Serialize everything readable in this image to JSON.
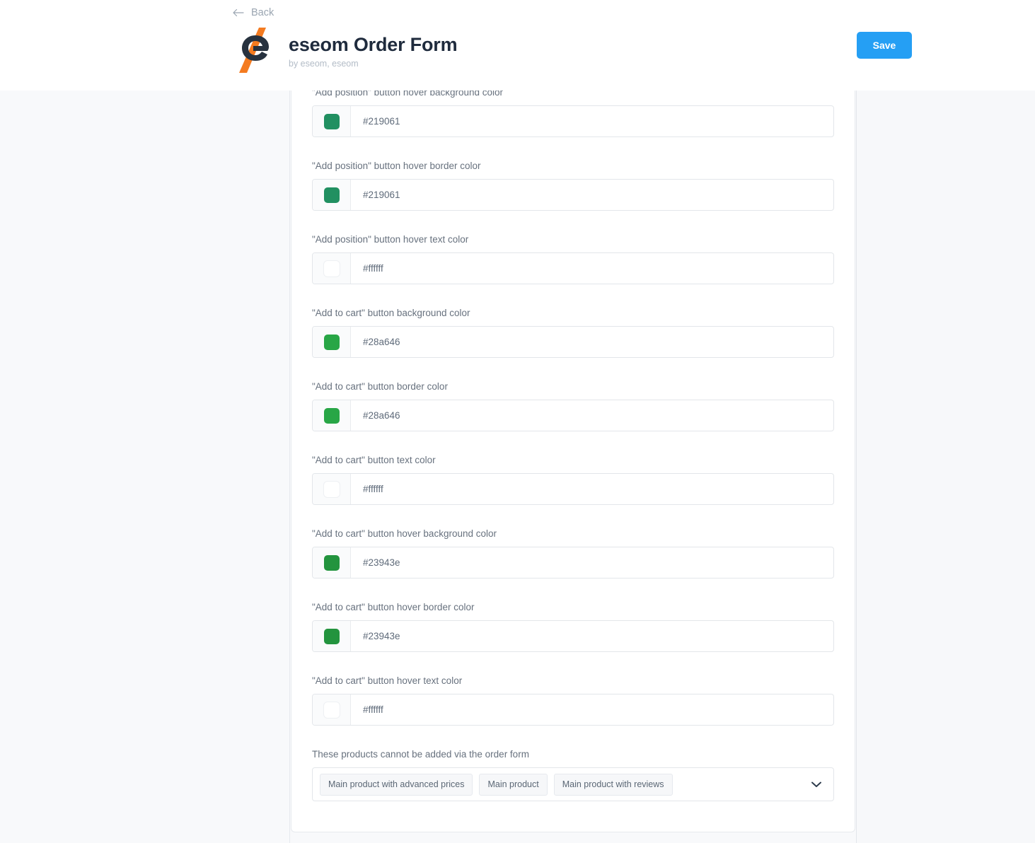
{
  "header": {
    "back_label": "Back",
    "back_icon": "arrow-left-icon",
    "logo_icon": "eseom-logo-icon",
    "title": "eseom Order Form",
    "subtitle": "by eseom, eseom",
    "save_label": "Save",
    "save_color": "#259ff4"
  },
  "form": {
    "fields": [
      {
        "label": "\"Add position\" button hover background color",
        "value": "#219061",
        "swatch": "#219061",
        "type": "color"
      },
      {
        "label": "\"Add position\" button hover border color",
        "value": "#219061",
        "swatch": "#219061",
        "type": "color"
      },
      {
        "label": "\"Add position\" button hover text color",
        "value": "#ffffff",
        "swatch": "#ffffff",
        "type": "color"
      },
      {
        "label": "\"Add to cart\" button background color",
        "value": "#28a646",
        "swatch": "#28a646",
        "type": "color"
      },
      {
        "label": "\"Add to cart\" button border color",
        "value": "#28a646",
        "swatch": "#28a646",
        "type": "color"
      },
      {
        "label": "\"Add to cart\" button text color",
        "value": "#ffffff",
        "swatch": "#ffffff",
        "type": "color"
      },
      {
        "label": "\"Add to cart\" button hover background color",
        "value": "#23943e",
        "swatch": "#23943e",
        "type": "color"
      },
      {
        "label": "\"Add to cart\" button hover border color",
        "value": "#23943e",
        "swatch": "#23943e",
        "type": "color"
      },
      {
        "label": "\"Add to cart\" button hover text color",
        "value": "#ffffff",
        "swatch": "#ffffff",
        "type": "color"
      }
    ],
    "excluded_products": {
      "label": "These products cannot be added via the order form",
      "chips": [
        "Main product with advanced prices",
        "Main product",
        "Main product with reviews"
      ],
      "chevron_icon": "chevron-down-icon"
    }
  }
}
